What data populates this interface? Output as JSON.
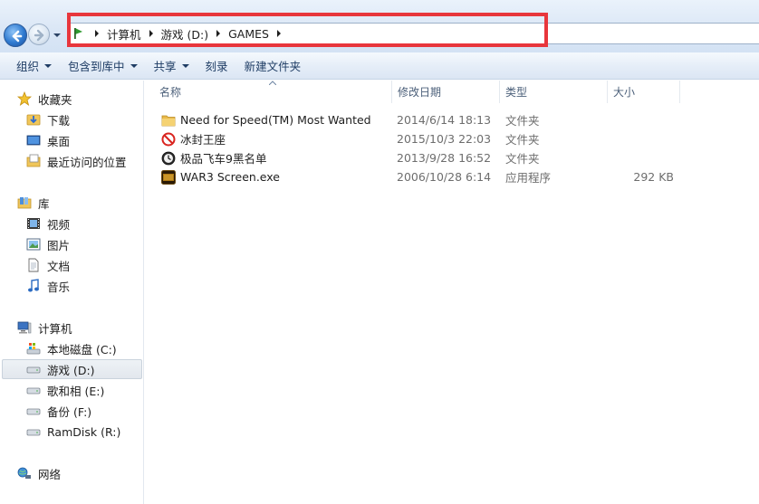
{
  "address": {
    "crumbs": [
      "计算机",
      "游戏 (D:)",
      "GAMES"
    ]
  },
  "toolbar": {
    "organize": "组织",
    "include_library": "包含到库中",
    "share": "共享",
    "burn": "刻录",
    "new_folder": "新建文件夹"
  },
  "sidebar": {
    "favorites": "收藏夹",
    "downloads": "下载",
    "desktop": "桌面",
    "recent": "最近访问的位置",
    "library": "库",
    "videos": "视频",
    "pictures": "图片",
    "documents": "文档",
    "music": "音乐",
    "computer": "计算机",
    "drive_c": "本地磁盘 (C:)",
    "drive_d": "游戏 (D:)",
    "drive_e": "歌和相 (E:)",
    "drive_f": "备份 (F:)",
    "drive_r": "RamDisk (R:)",
    "network": "网络"
  },
  "columns": {
    "name": "名称",
    "modified": "修改日期",
    "type": "类型",
    "size": "大小"
  },
  "files": [
    {
      "name": "Need for Speed(TM) Most Wanted",
      "modified": "2014/6/14 18:13",
      "type": "文件夹",
      "size": "",
      "icon": "folder-icon"
    },
    {
      "name": "冰封王座",
      "modified": "2015/10/3 22:03",
      "type": "文件夹",
      "size": "",
      "icon": "no-entry-icon"
    },
    {
      "name": "极品飞车9黑名单",
      "modified": "2013/9/28 16:52",
      "type": "文件夹",
      "size": "",
      "icon": "clock-icon"
    },
    {
      "name": "WAR3 Screen.exe",
      "modified": "2006/10/28 6:14",
      "type": "应用程序",
      "size": "292 KB",
      "icon": "warcraft-app-icon"
    }
  ],
  "colors": {
    "highlight": "#e8363c",
    "toolbar_text": "#1e3c64",
    "meta_text": "#6d6d6d"
  }
}
